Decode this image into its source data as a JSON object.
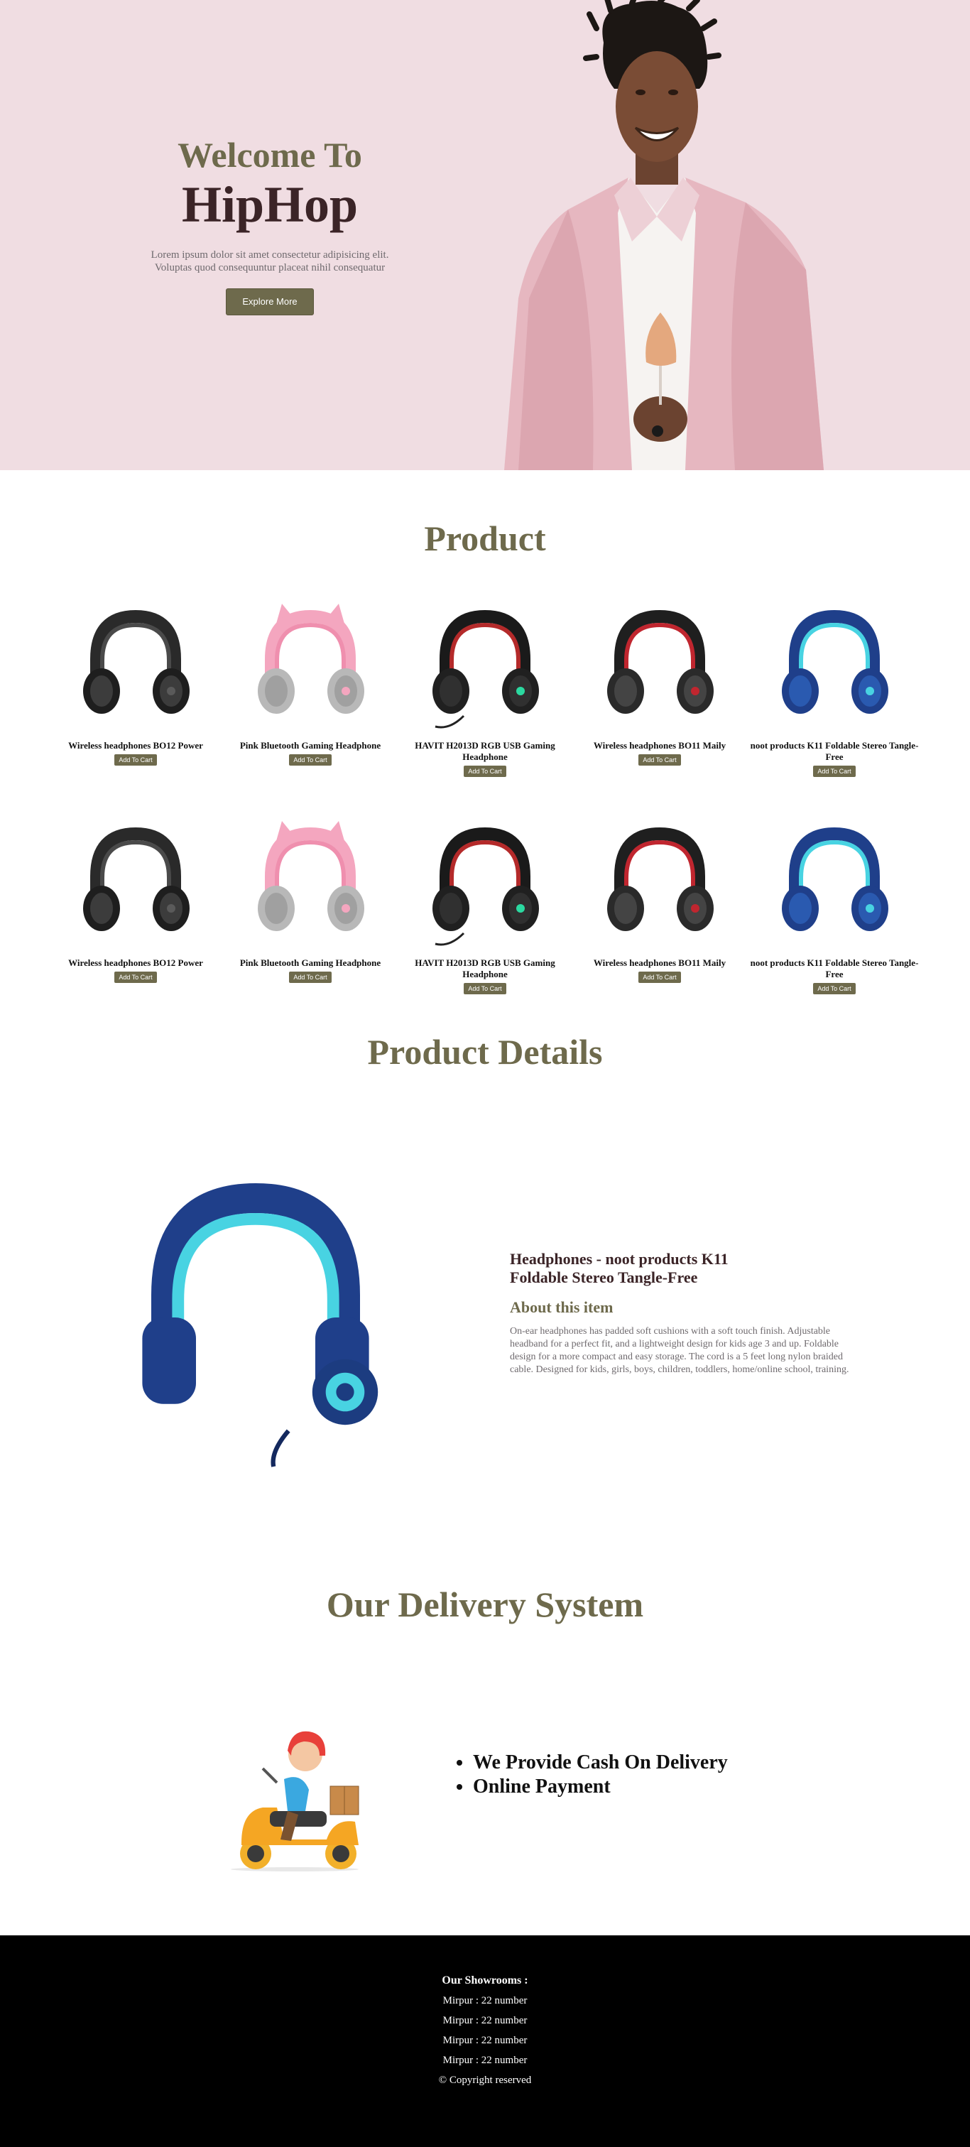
{
  "hero": {
    "welcome": "Welcome To",
    "title": "HipHop",
    "description_line1": "Lorem ipsum dolor sit amet consectetur adipisicing elit.",
    "description_line2": "Voluptas quod consequuntur placeat nihil consequatur",
    "cta_label": "Explore More"
  },
  "products": {
    "title": "Product",
    "cart_label": "Add To Cart",
    "items": [
      {
        "name": "Wireless headphones BO12 Power",
        "style": "black"
      },
      {
        "name": "Pink Bluetooth Gaming Headphone",
        "style": "pink"
      },
      {
        "name": "HAVIT H2013D RGB USB Gaming Headphone",
        "style": "rgb"
      },
      {
        "name": "Wireless headphones BO11 Maily",
        "style": "red"
      },
      {
        "name": "noot products K11 Foldable Stereo Tangle-Free",
        "style": "blue"
      },
      {
        "name": "Wireless headphones BO12 Power",
        "style": "black"
      },
      {
        "name": "Pink Bluetooth Gaming Headphone",
        "style": "pink"
      },
      {
        "name": "HAVIT H2013D RGB USB Gaming Headphone",
        "style": "rgb"
      },
      {
        "name": "Wireless headphones BO11 Maily",
        "style": "red"
      },
      {
        "name": "noot products K11 Foldable Stereo Tangle-Free",
        "style": "blue"
      }
    ]
  },
  "details": {
    "title": "Product Details",
    "product_name": "Headphones - noot products K11 Foldable Stereo Tangle-Free",
    "subtitle": "About this item",
    "description": "On-ear headphones has padded soft cushions with a soft touch finish. Adjustable headband for a perfect fit, and a lightweight design for kids age 3 and up. Foldable design for a more compact and easy storage. The cord is a 5 feet long nylon braided cable. Designed for kids, girls, boys, children, toddlers, home/online school, training."
  },
  "delivery": {
    "title": "Our Delivery System",
    "options": [
      "We Provide Cash On Delivery",
      "Online Payment"
    ]
  },
  "footer": {
    "title": "Our Showrooms :",
    "showrooms": [
      "Mirpur : 22 number",
      "Mirpur : 22 number",
      "Mirpur : 22 number",
      "Mirpur : 22 number"
    ],
    "copyright": "© Copyright reserved"
  },
  "colors": {
    "accent": "#6e6a4c",
    "hero_bg": "#f0dde2",
    "heading_dark": "#3b2427",
    "footer_bg": "#000000"
  }
}
